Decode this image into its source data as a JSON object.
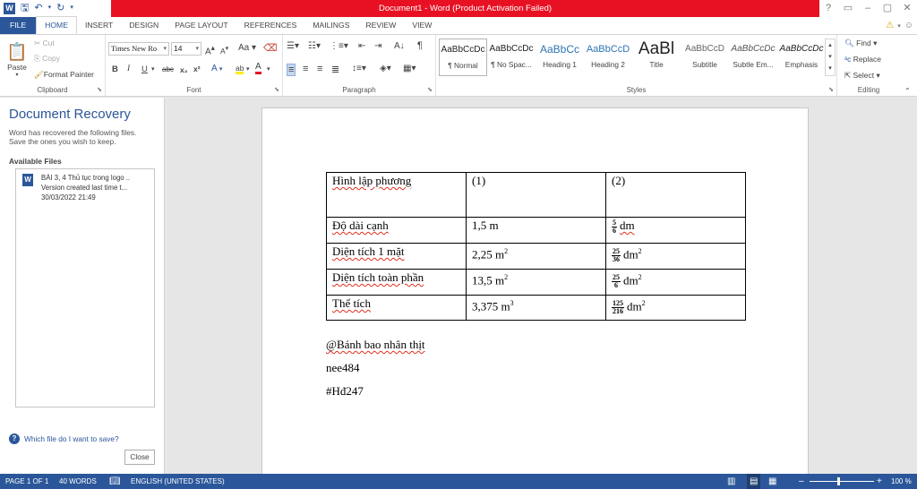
{
  "title": "Document1 - Word (Product Activation Failed)",
  "window_controls": [
    "?",
    "▭",
    "–",
    "▢",
    "✕"
  ],
  "tabs": [
    "FILE",
    "HOME",
    "INSERT",
    "DESIGN",
    "PAGE LAYOUT",
    "REFERENCES",
    "MAILINGS",
    "REVIEW",
    "VIEW"
  ],
  "active_tab": "HOME",
  "clipboard": {
    "paste": "Paste",
    "cut": "Cut",
    "copy": "Copy",
    "format_painter": "Format Painter",
    "label": "Clipboard"
  },
  "font": {
    "name": "Times New Ro",
    "size": "14",
    "label": "Font",
    "bold": "B",
    "italic": "I",
    "underline": "U",
    "strike": "abc",
    "sub": "x₂",
    "sup": "x²",
    "grow": "A",
    "shrink": "A",
    "case": "Aa",
    "text_effects": "A",
    "highlight": "ab",
    "color": "A"
  },
  "paragraph": {
    "label": "Paragraph"
  },
  "styles": {
    "label": "Styles",
    "items": [
      {
        "preview": "AaBbCcDc",
        "name": "¶ Normal"
      },
      {
        "preview": "AaBbCcDc",
        "name": "¶ No Spac..."
      },
      {
        "preview": "AaBbCc",
        "name": "Heading 1"
      },
      {
        "preview": "AaBbCcD",
        "name": "Heading 2"
      },
      {
        "preview": "AaBl",
        "name": "Title"
      },
      {
        "preview": "AaBbCcD",
        "name": "Subtitle"
      },
      {
        "preview": "AaBbCcDc",
        "name": "Subtle Em..."
      },
      {
        "preview": "AaBbCcDc",
        "name": "Emphasis"
      }
    ]
  },
  "editing": {
    "find": "Find",
    "replace": "Replace",
    "select": "Select",
    "label": "Editing"
  },
  "recovery": {
    "title": "Document Recovery",
    "desc1": "Word has recovered the following files.",
    "desc2": "Save the ones you wish to keep.",
    "available": "Available Files",
    "file_line1": "BÀI 3, 4 Thủ tục trong logo ..",
    "file_line2": "Version created last time t...",
    "file_line3": "30/03/2022 21:49",
    "help": "Which file do I want to save?",
    "close": "Close"
  },
  "table": {
    "header": [
      "Hình lập phương",
      "(1)",
      "(2)"
    ],
    "rows": [
      {
        "label": "Độ dài cạnh",
        "c1": "1,5 m",
        "num": "5",
        "den": "6",
        "unit": "dm",
        "sup": ""
      },
      {
        "label": "Diện tích 1 mặt",
        "c1": "2,25 m",
        "c1sup": "2",
        "num": "25",
        "den": "36",
        "unit": "dm",
        "sup": "2"
      },
      {
        "label": "Diện tích toàn phần",
        "c1": "13,5 m",
        "c1sup": "2",
        "num": "25",
        "den": "6",
        "unit": "dm",
        "sup": "2"
      },
      {
        "label": "Thể tích",
        "c1": "3,375 m",
        "c1sup": "3",
        "num": "125",
        "den": "216",
        "unit": "dm",
        "sup": "2"
      }
    ]
  },
  "paragraphs": [
    "@Bánh bao nhân thịt",
    "nee484",
    "#Hđ247"
  ],
  "status": {
    "page": "PAGE 1 OF 1",
    "words": "40 WORDS",
    "language": "ENGLISH (UNITED STATES)",
    "zoom": "100 %",
    "zoom_minus": "–",
    "zoom_plus": "+"
  }
}
